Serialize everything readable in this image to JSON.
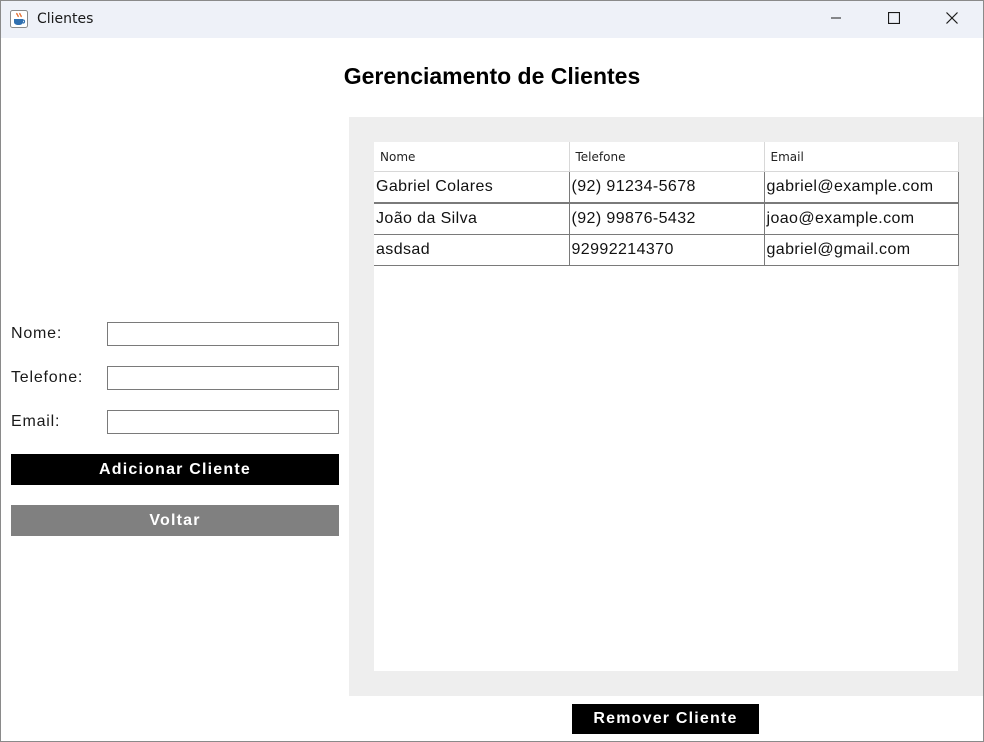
{
  "window": {
    "title": "Clientes"
  },
  "page": {
    "heading": "Gerenciamento de Clientes"
  },
  "form": {
    "name_label": "Nome:",
    "phone_label": "Telefone:",
    "email_label": "Email:",
    "name_value": "",
    "phone_value": "",
    "email_value": "",
    "add_button": "Adicionar Cliente",
    "back_button": "Voltar"
  },
  "table": {
    "columns": [
      "Nome",
      "Telefone",
      "Email"
    ],
    "rows": [
      [
        "Gabriel Colares",
        "(92) 91234-5678",
        "gabriel@example.com"
      ],
      [
        "João da Silva",
        "(92) 99876-5432",
        "joao@example.com"
      ],
      [
        "asdsad",
        "92992214370",
        "gabriel@gmail.com"
      ]
    ]
  },
  "actions": {
    "remove_button": "Remover Cliente"
  },
  "icons": {
    "app": "java-coffee-cup-icon",
    "minimize": "minimize-icon",
    "maximize": "maximize-icon",
    "close": "close-icon"
  },
  "colors": {
    "primary_button": "#000000",
    "secondary_button": "#808080",
    "table_panel_bg": "#eeeeee",
    "titlebar_bg": "#eef1f8"
  }
}
